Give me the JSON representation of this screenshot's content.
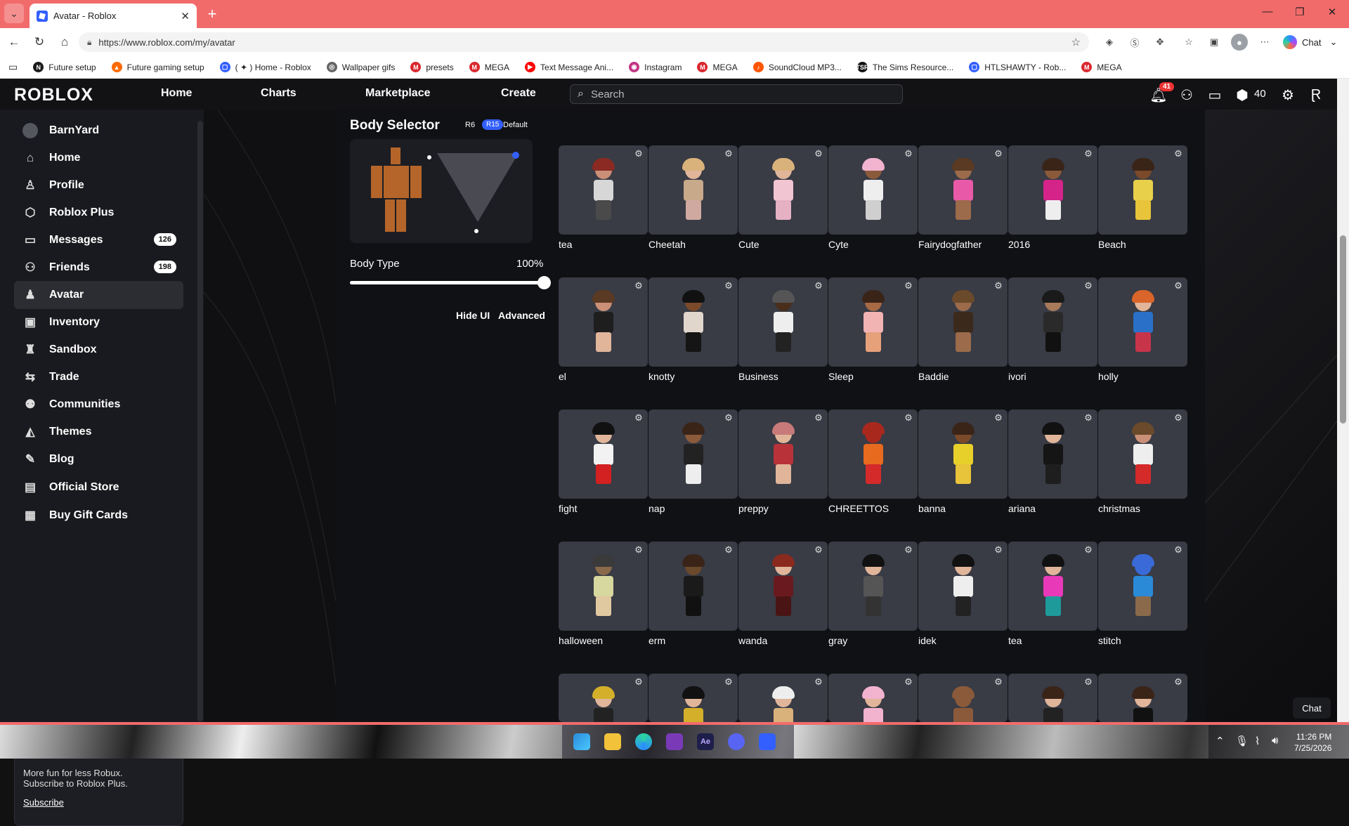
{
  "browser": {
    "tab_title": "Avatar - Roblox",
    "url": "https://www.roblox.com/my/avatar",
    "chat_label": "Chat",
    "bookmarks": [
      {
        "label": "Future setup",
        "color": "#1a1a1a",
        "glyph": "N"
      },
      {
        "label": "Future gaming setup",
        "color": "#ff6a00",
        "glyph": "▲"
      },
      {
        "label": "( ✦ ) Home - Roblox",
        "color": "#335fff",
        "glyph": "▢"
      },
      {
        "label": "Wallpaper gifs",
        "color": "#666666",
        "glyph": "◎"
      },
      {
        "label": "presets",
        "color": "#d9272e",
        "glyph": "M"
      },
      {
        "label": "MEGA",
        "color": "#d9272e",
        "glyph": "M"
      },
      {
        "label": "Text Message Ani...",
        "color": "#ff0000",
        "glyph": "▶"
      },
      {
        "label": "Instagram",
        "color": "#c13584",
        "glyph": "◉"
      },
      {
        "label": "MEGA",
        "color": "#d9272e",
        "glyph": "M"
      },
      {
        "label": "SoundCloud MP3...",
        "color": "#ff5500",
        "glyph": "♪"
      },
      {
        "label": "The Sims Resource...",
        "color": "#111111",
        "glyph": "TSR"
      },
      {
        "label": "HTLSHAWTY - Rob...",
        "color": "#335fff",
        "glyph": "▢"
      },
      {
        "label": "MEGA",
        "color": "#d9272e",
        "glyph": "M"
      }
    ]
  },
  "header": {
    "logo": "ROBLOX",
    "nav": [
      "Home",
      "Charts",
      "Marketplace",
      "Create"
    ],
    "search_placeholder": "Search",
    "notifications_count": "41",
    "robux": "40"
  },
  "sidebar": {
    "username": "BarnYard",
    "items": [
      {
        "label": "Home",
        "icon": "⌂",
        "name": "home"
      },
      {
        "label": "Profile",
        "icon": "♙",
        "name": "profile"
      },
      {
        "label": "Roblox Plus",
        "icon": "⬡",
        "name": "roblox-plus"
      },
      {
        "label": "Messages",
        "icon": "▭",
        "name": "messages",
        "badge": "126"
      },
      {
        "label": "Friends",
        "icon": "⚇",
        "name": "friends",
        "badge": "198"
      },
      {
        "label": "Avatar",
        "icon": "♟",
        "name": "avatar",
        "active": true
      },
      {
        "label": "Inventory",
        "icon": "▣",
        "name": "inventory"
      },
      {
        "label": "Sandbox",
        "icon": "♜",
        "name": "sandbox"
      },
      {
        "label": "Trade",
        "icon": "⇆",
        "name": "trade"
      },
      {
        "label": "Communities",
        "icon": "⚉",
        "name": "communities"
      },
      {
        "label": "Themes",
        "icon": "◭",
        "name": "themes"
      },
      {
        "label": "Blog",
        "icon": "✎",
        "name": "blog"
      },
      {
        "label": "Official Store",
        "icon": "▤",
        "name": "official-store"
      },
      {
        "label": "Buy Gift Cards",
        "icon": "▦",
        "name": "buy-gift-cards"
      }
    ],
    "promo": {
      "line1": "More fun for less Robux.",
      "line2": "Subscribe to Roblox Plus.",
      "link": "Subscribe"
    }
  },
  "body_selector": {
    "title": "Body Selector",
    "r6": "R6",
    "r15": "R15",
    "default": "Default",
    "body_type_label": "Body Type",
    "body_type_value": "100%",
    "body_type_level": 1.0,
    "hide_ui": "Hide UI",
    "advanced": "Advanced"
  },
  "outfits": [
    {
      "label": "tea",
      "hair": "#8a2a22",
      "torso": "#d7d7d7",
      "legs": "#4a4a4a",
      "skin": "#c99077"
    },
    {
      "label": "Cheetah",
      "hair": "#d9b27b",
      "torso": "#c8a98a",
      "legs": "#cfa9a0",
      "skin": "#e0b59a"
    },
    {
      "label": "Cute",
      "hair": "#d9b27b",
      "torso": "#f1c5d2",
      "legs": "#e6b1c3",
      "skin": "#e0b59a"
    },
    {
      "label": "Cyte",
      "hair": "#f2b3cf",
      "torso": "#eeeeee",
      "legs": "#cfcfcf",
      "skin": "#8a5a3a"
    },
    {
      "label": "Fairydogfather",
      "hair": "#5a3a22",
      "torso": "#e85aa8",
      "legs": "#9b6b4b",
      "skin": "#9b6b4b"
    },
    {
      "label": "2016",
      "hair": "#3a2418",
      "torso": "#d4248a",
      "legs": "#eeeeee",
      "skin": "#8a5a3a"
    },
    {
      "label": "Beach",
      "hair": "#3a2418",
      "torso": "#e8d04a",
      "legs": "#e8c43a",
      "skin": "#7a4a2a"
    },
    {
      "label": "el",
      "hair": "#5a3a22",
      "torso": "#1e1e1e",
      "legs": "#e0b59a",
      "skin": "#c99077"
    },
    {
      "label": "knotty",
      "hair": "#111111",
      "torso": "#e0d6cc",
      "legs": "#151515",
      "skin": "#7a4a2a"
    },
    {
      "label": "Business",
      "hair": "#555555",
      "torso": "#eeeeee",
      "legs": "#222222",
      "skin": "#4a2e1c"
    },
    {
      "label": "Sleep",
      "hair": "#3a2418",
      "torso": "#f2b3b3",
      "legs": "#e6a07a",
      "skin": "#a86a44"
    },
    {
      "label": "Baddie",
      "hair": "#6a4a2a",
      "torso": "#3b2a1c",
      "legs": "#9b6b4b",
      "skin": "#9b6b4b"
    },
    {
      "label": "ivori",
      "hair": "#1a1a1a",
      "torso": "#2a2a2a",
      "legs": "#111111",
      "skin": "#a87a5a"
    },
    {
      "label": "holly",
      "hair": "#d9652a",
      "torso": "#2a70c8",
      "legs": "#c8344a",
      "skin": "#e0b59a"
    },
    {
      "label": "fight",
      "hair": "#111111",
      "torso": "#f2f2f2",
      "legs": "#d32020",
      "skin": "#e0b59a"
    },
    {
      "label": "nap",
      "hair": "#3a2418",
      "torso": "#222222",
      "legs": "#eeeeee",
      "skin": "#8a5a3a"
    },
    {
      "label": "preppy",
      "hair": "#c87a7a",
      "torso": "#b8323a",
      "legs": "#e0b59a",
      "skin": "#e0b59a"
    },
    {
      "label": "CHREETTOS",
      "hair": "#a8281e",
      "torso": "#e86a1e",
      "legs": "#d42a2a",
      "skin": "#a8281e"
    },
    {
      "label": "banna",
      "hair": "#3a2418",
      "torso": "#e8d02a",
      "legs": "#e8c43a",
      "skin": "#7a4a2a"
    },
    {
      "label": "ariana",
      "hair": "#111111",
      "torso": "#151515",
      "legs": "#1e1e1e",
      "skin": "#e0b59a"
    },
    {
      "label": "christmas",
      "hair": "#6a4a2a",
      "torso": "#eeeeee",
      "legs": "#d42a2a",
      "skin": "#c99077"
    },
    {
      "label": "halloween",
      "hair": "#3a3a3a",
      "torso": "#d7d7a0",
      "legs": "#e0c8a0",
      "skin": "#8a6a4a"
    },
    {
      "label": "erm",
      "hair": "#3a2418",
      "torso": "#1a1a1a",
      "legs": "#111111",
      "skin": "#6a4a2a"
    },
    {
      "label": "wanda",
      "hair": "#8a2a1e",
      "torso": "#6a1a1e",
      "legs": "#4a1414",
      "skin": "#e0b59a"
    },
    {
      "label": "gray",
      "hair": "#111111",
      "torso": "#555555",
      "legs": "#333333",
      "skin": "#e0b59a"
    },
    {
      "label": "idek",
      "hair": "#111111",
      "torso": "#eeeeee",
      "legs": "#222222",
      "skin": "#e0b59a"
    },
    {
      "label": "tea",
      "hair": "#111111",
      "torso": "#e83ab8",
      "legs": "#1e9a9a",
      "skin": "#e0b59a"
    },
    {
      "label": "stitch",
      "hair": "#3a6ad8",
      "torso": "#2a8ad8",
      "legs": "#8a6a4a",
      "skin": "#3a6ad8"
    },
    {
      "label": "",
      "hair": "#d4b02a",
      "torso": "#222222",
      "legs": "#222222",
      "skin": "#e0b59a"
    },
    {
      "label": "",
      "hair": "#111111",
      "torso": "#d4b02a",
      "legs": "#222222",
      "skin": "#e0b59a"
    },
    {
      "label": "",
      "hair": "#eeeeee",
      "torso": "#d9b27b",
      "legs": "#222222",
      "skin": "#e0b59a"
    },
    {
      "label": "",
      "hair": "#f2b3cf",
      "torso": "#f2b3cf",
      "legs": "#222222",
      "skin": "#e0b59a"
    },
    {
      "label": "",
      "hair": "#8a5a3a",
      "torso": "#8a5a3a",
      "legs": "#222222",
      "skin": "#8a5a3a"
    },
    {
      "label": "",
      "hair": "#3a2418",
      "torso": "#222222",
      "legs": "#222222",
      "skin": "#e0b59a"
    },
    {
      "label": "",
      "hair": "#3a2418",
      "torso": "#111111",
      "legs": "#222222",
      "skin": "#e0b59a"
    }
  ],
  "chat_float": "Chat",
  "taskbar": {
    "time": "11:26 PM",
    "date": "7/25/2026"
  }
}
